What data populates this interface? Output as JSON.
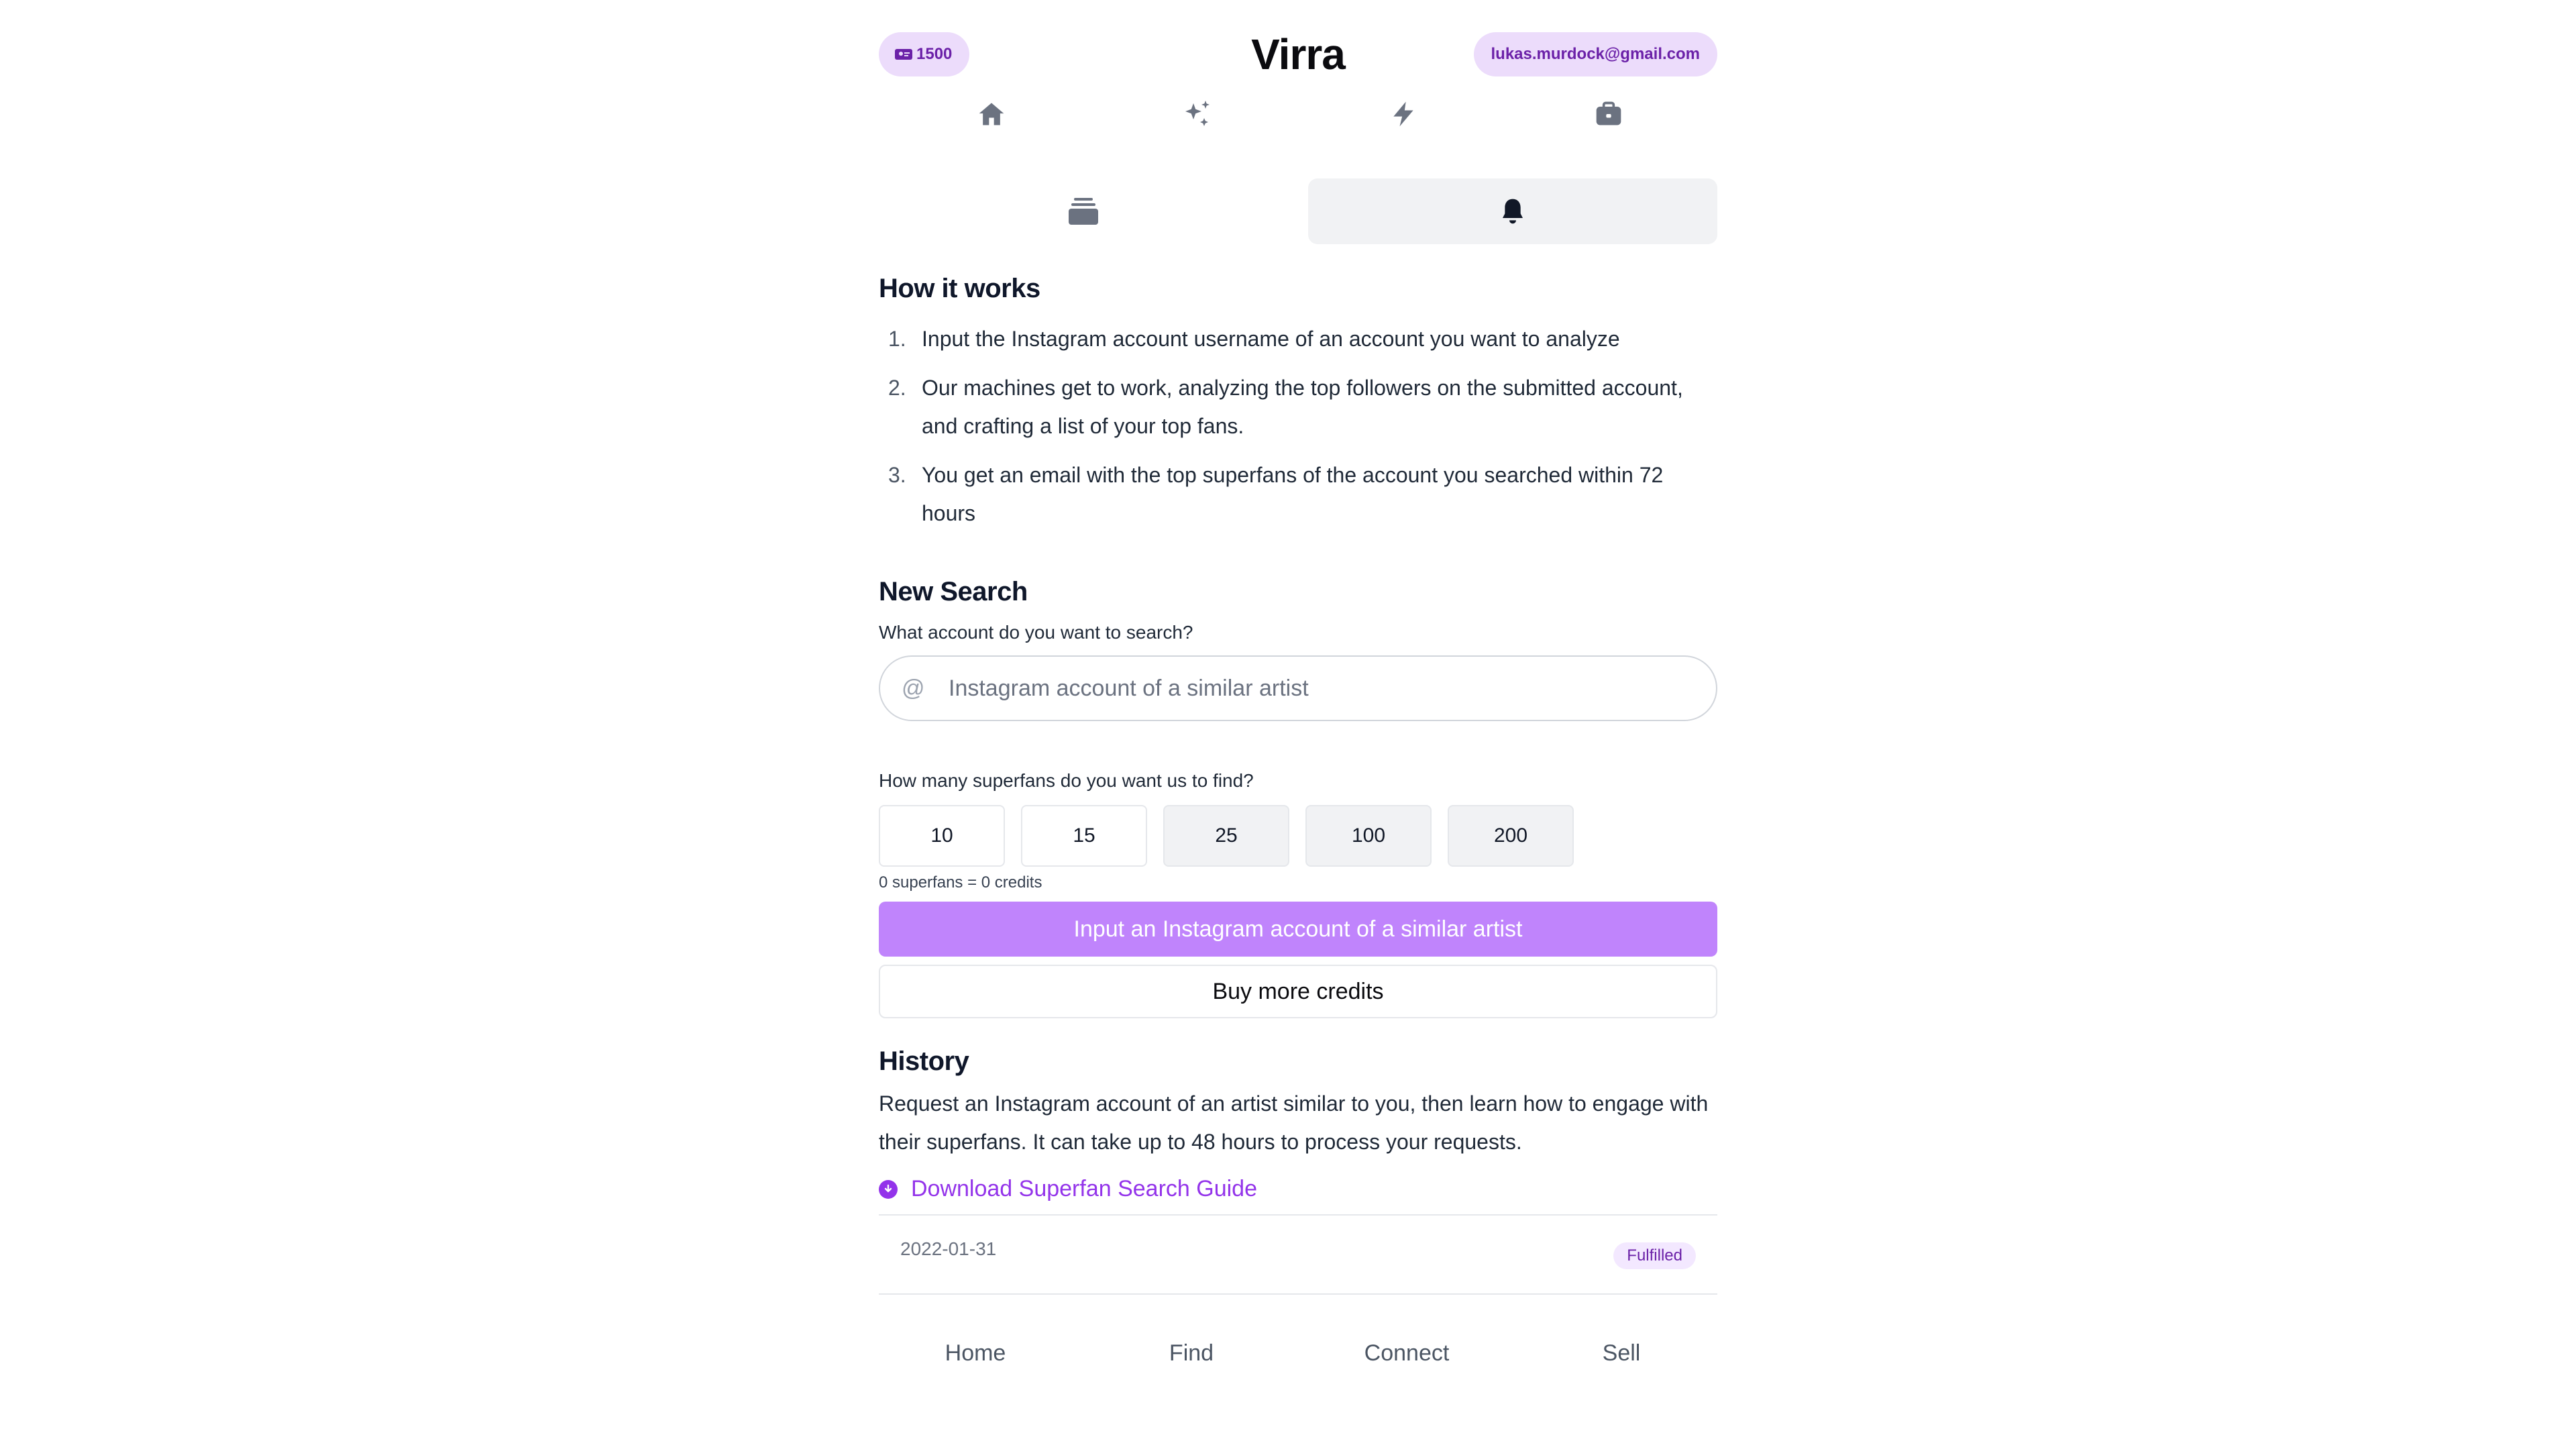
{
  "app": {
    "title": "Virra",
    "credits": "1500",
    "user_email": "lukas.murdock@gmail.com"
  },
  "top_nav": [
    {
      "icon": "home-icon"
    },
    {
      "icon": "sparkles-icon"
    },
    {
      "icon": "lightning-icon"
    },
    {
      "icon": "briefcase-icon"
    }
  ],
  "sub_tabs": [
    {
      "icon": "inbox-stack-icon",
      "active": false
    },
    {
      "icon": "bell-icon",
      "active": true
    }
  ],
  "how_it_works": {
    "heading": "How it works",
    "steps": [
      {
        "num": "1.",
        "text": "Input the Instagram account username of an account you want to analyze"
      },
      {
        "num": "2.",
        "text": "Our machines get to work, analyzing the top followers on the submitted account, and crafting a list of your top fans."
      },
      {
        "num": "3.",
        "text": "You get an email with the top superfans of the account you searched within 72 hours"
      }
    ]
  },
  "new_search": {
    "heading": "New Search",
    "account_label": "What account do you want to search?",
    "account_prefix": "@",
    "account_placeholder": "Instagram account of a similar artist",
    "account_value": "",
    "count_label": "How many superfans do you want us to find?",
    "count_options": [
      "10",
      "15",
      "25",
      "100",
      "200"
    ],
    "cost_hint": "0 superfans = 0 credits",
    "submit_label": "Input an Instagram account of a similar artist",
    "buy_label": "Buy more credits"
  },
  "history": {
    "heading": "History",
    "description": "Request an Instagram account of an artist similar to you, then learn how to engage with their superfans. It can take up to 48 hours to process your requests.",
    "guide_link": "Download Superfan Search Guide",
    "rows": [
      {
        "date": "2022-01-31",
        "status": "Fulfilled"
      }
    ]
  },
  "bottom_nav": [
    "Home",
    "Find",
    "Connect",
    "Sell"
  ],
  "colors": {
    "accent": "#9333ea",
    "button_primary": "#c084fc",
    "pill_bg": "#ecdcfb"
  }
}
